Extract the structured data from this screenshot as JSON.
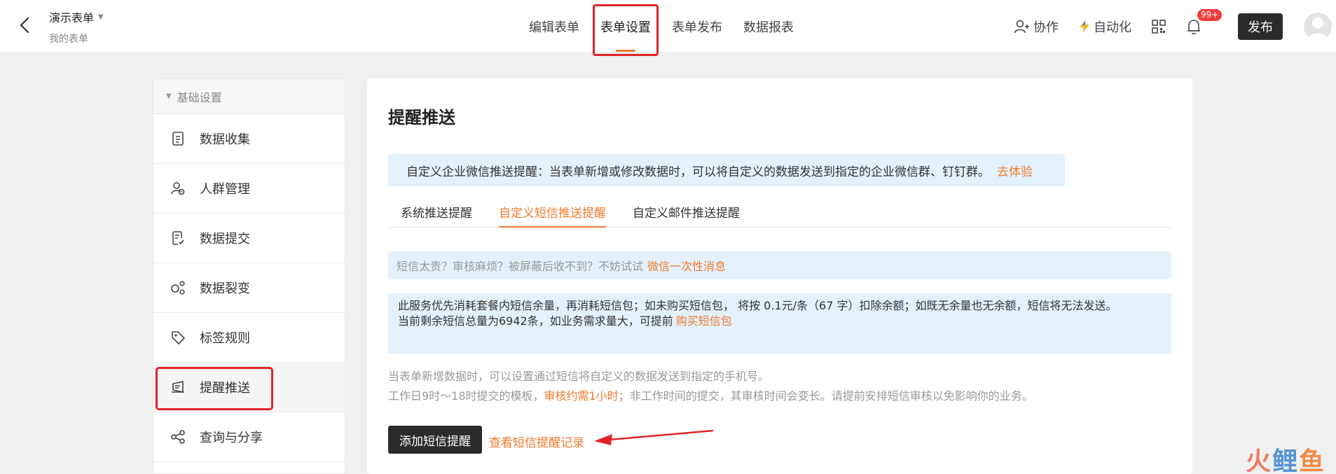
{
  "header": {
    "form_title": "演示表单",
    "form_subtitle": "我的表单",
    "tabs": [
      {
        "label": "编辑表单",
        "active": false
      },
      {
        "label": "表单设置",
        "active": true
      },
      {
        "label": "表单发布",
        "active": false
      },
      {
        "label": "数据报表",
        "active": false
      }
    ],
    "collab_label": "协作",
    "automation_label": "自动化",
    "notification_badge": "99+",
    "publish_label": "发布"
  },
  "sidebar": {
    "section_title": "基础设置",
    "items": [
      {
        "label": "数据收集",
        "icon": "document-icon",
        "active": false
      },
      {
        "label": "人群管理",
        "icon": "user-group-icon",
        "active": false
      },
      {
        "label": "数据提交",
        "icon": "submit-doc-icon",
        "active": false
      },
      {
        "label": "数据裂变",
        "icon": "fission-icon",
        "active": false
      },
      {
        "label": "标签规则",
        "icon": "tag-icon",
        "active": false
      },
      {
        "label": "提醒推送",
        "icon": "notify-icon",
        "active": true
      },
      {
        "label": "查询与分享",
        "icon": "share-icon",
        "active": false
      }
    ]
  },
  "main": {
    "title": "提醒推送",
    "promo_text": "自定义企业微信推送提醒：当表单新增或修改数据时，可以将自定义的数据发送到指定的企业微信群、钉钉群。",
    "promo_link": "去体验",
    "subtabs": [
      {
        "label": "系统推送提醒",
        "active": false
      },
      {
        "label": "自定义短信推送提醒",
        "active": true
      },
      {
        "label": "自定义邮件推送提醒",
        "active": false
      }
    ],
    "tip_text": "短信太贵？审核麻烦？被屏蔽后收不到？不妨试试",
    "tip_link": "微信一次性消息",
    "info_line1": "此服务优先消耗套餐内短信余量，再消耗短信包；如未购买短信包， 将按 0.1元/条（67 字）扣除余额；如既无余量也无余额，短信将无法发送。",
    "info_line2": "当前剩余短信总量为6942条，如业务需求量大，可提前",
    "info_link": "购买短信包",
    "desc_line1": "当表单新增数据时，可以设置通过短信将自定义的数据发送到指定的手机号。",
    "desc_line2_prefix": "工作日9时～18时提交的模板，",
    "desc_line2_highlight": "审核约需1小时",
    "desc_line2_suffix": "；非工作时间的提交，其审核时间会变长。请提前安排短信审核以免影响你的业务。",
    "add_button": "添加短信提醒",
    "record_link": "查看短信提醒记录"
  },
  "watermark": {
    "c1": "火",
    "c2": "鲤",
    "c3": "鱼"
  },
  "colors": {
    "accent": "#f07a2d",
    "highlight": "#e0242a",
    "info_bg": "#e4f1fb",
    "dark_button": "#2b2b2b"
  }
}
